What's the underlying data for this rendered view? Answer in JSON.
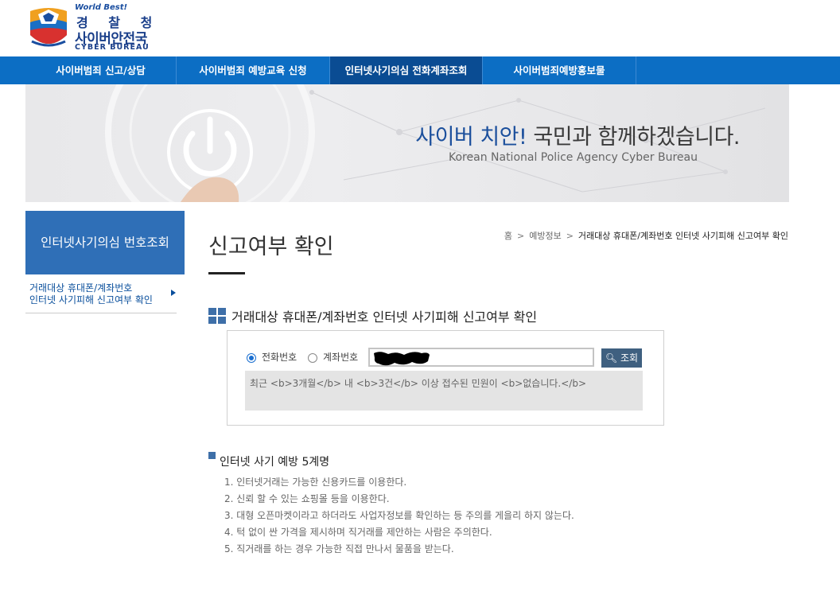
{
  "logo": {
    "world": "World Best!",
    "title_kr": "경 찰 청",
    "subtitle_kr": "사이버안전국",
    "title_en": "CYBER BUREAU"
  },
  "topnav": [
    {
      "label": "사이버범죄 신고/상담",
      "active": false
    },
    {
      "label": "사이버범죄 예방교육 신청",
      "active": false
    },
    {
      "label": "인터넷사기의심 전화계좌조회",
      "active": true
    },
    {
      "label": "사이버범죄예방홍보물",
      "active": false
    }
  ],
  "banner": {
    "title_blue": "사이버 치안!",
    "title_rest": " 국민과 함께하겠습니다.",
    "subtitle": "Korean National Police Agency Cyber Bureau"
  },
  "sidebar": {
    "heading": "인터넷사기의심 번호조회",
    "item_line1": "거래대상 휴대폰/계좌번호",
    "item_line2": "인터넷 사기피해 신고여부 확인"
  },
  "page": {
    "title": "신고여부 확인",
    "breadcrumb": [
      "홈",
      "예방정보",
      "거래대상 휴대폰/계좌번호 인터넷 사기피해 신고여부 확인"
    ],
    "section_title": "거래대상 휴대폰/계좌번호 인터넷 사기피해 신고여부 확인"
  },
  "search": {
    "radio_phone": "전화번호",
    "radio_account": "계좌번호",
    "selected": "phone",
    "button": "조회",
    "result_text": "최근 <b>3개월</b> 내 <b>3건</b> 이상 접수된 민원이 <b>없습니다.</b>"
  },
  "tips": {
    "title": "인터넷 사기 예방 5계명",
    "items": [
      "1. 인터넷거래는 가능한 신용카드를 이용한다.",
      "2. 신뢰 할 수 있는 쇼핑몰 등을 이용한다.",
      "3. 대형 오픈마켓이라고 하더라도 사업자정보를 확인하는 등 주의를 게을리 하지 않는다.",
      "4. 턱 없이 싼 가격을 제시하며 직거래를 제안하는 사람은 주의한다.",
      "5. 직거래를 하는 경우 가능한 직접 만나서 물품을 받는다."
    ]
  },
  "colors": {
    "nav": "#0c6ec4",
    "nav_active": "#0a4c93",
    "sidebar_head": "#2f6fb7",
    "button": "#3f6080"
  }
}
